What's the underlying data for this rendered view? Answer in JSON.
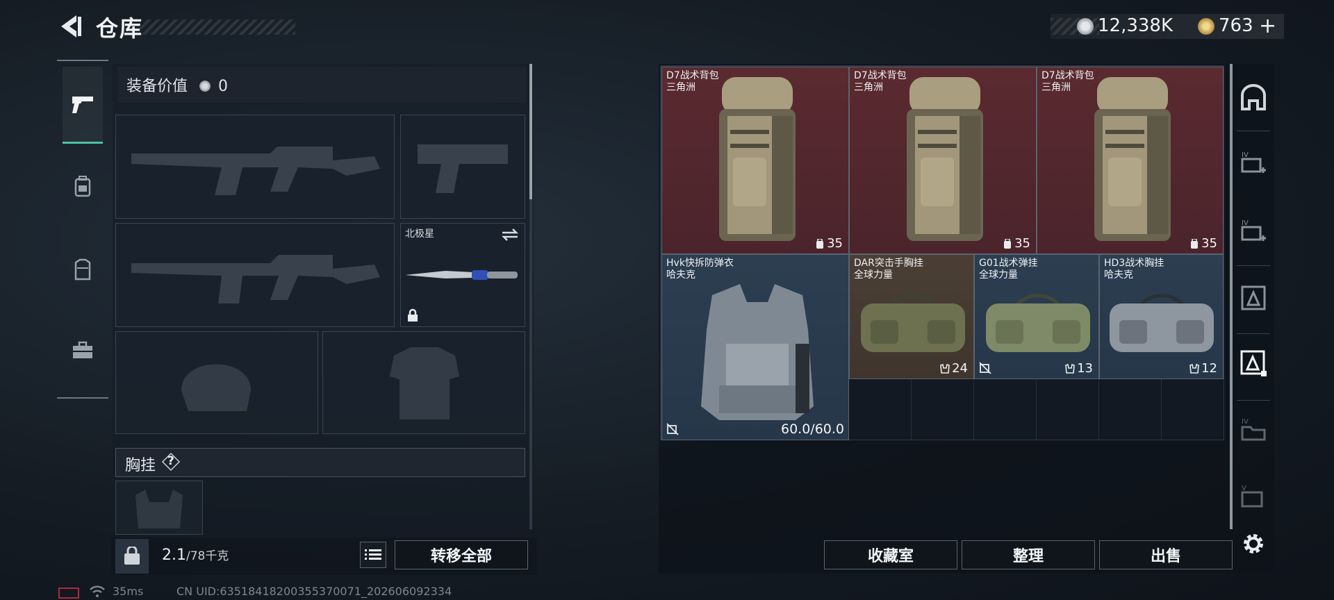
{
  "header": {
    "title": "仓库",
    "currency_primary": "12,338K",
    "currency_secondary": "763",
    "add_label": "+"
  },
  "left_tabs": [
    {
      "icon": "pistol-icon",
      "active": true
    },
    {
      "icon": "backpack-icon",
      "active": false
    },
    {
      "icon": "vest-icon",
      "active": false
    },
    {
      "icon": "toolbox-icon",
      "active": false
    }
  ],
  "loadout": {
    "equip_value_label": "装备价值",
    "equip_value": "0",
    "melee_name": "北极星",
    "chest_rig_label": "胸挂",
    "help_label": "?",
    "weight_current": "2.1",
    "weight_max": "/78千克",
    "transfer_all_label": "转移全部"
  },
  "stash": {
    "items": [
      {
        "name": "D7战术背包",
        "sub": "三角洲",
        "count": "35",
        "bg": "red"
      },
      {
        "name": "D7战术背包",
        "sub": "三角洲",
        "count": "35",
        "bg": "red"
      },
      {
        "name": "D7战术背包",
        "sub": "三角洲",
        "count": "35",
        "bg": "red"
      },
      {
        "name": "Hvk快拆防弹衣",
        "sub": "哈夫克",
        "durability": "60.0/60.0",
        "bg": "blue"
      },
      {
        "name": "DAR突击手胸挂",
        "sub": "全球力量",
        "count": "24",
        "bg": "brown"
      },
      {
        "name": "G01战术弹挂",
        "sub": "全球力量",
        "count": "13",
        "bg": "blue"
      },
      {
        "name": "HD3战术胸挂",
        "sub": "哈夫克",
        "count": "12",
        "bg": "blue"
      }
    ],
    "buttons": {
      "collection": "收藏室",
      "organize": "整理",
      "sell": "出售"
    }
  },
  "status_bar": {
    "ping": "35ms",
    "uid": "CN UID:635184182003553700​71_202606092334"
  },
  "colors": {
    "accent_green": "#4cc3a0",
    "rare_red": "#5a2a30",
    "blue": "#2d3e51"
  }
}
